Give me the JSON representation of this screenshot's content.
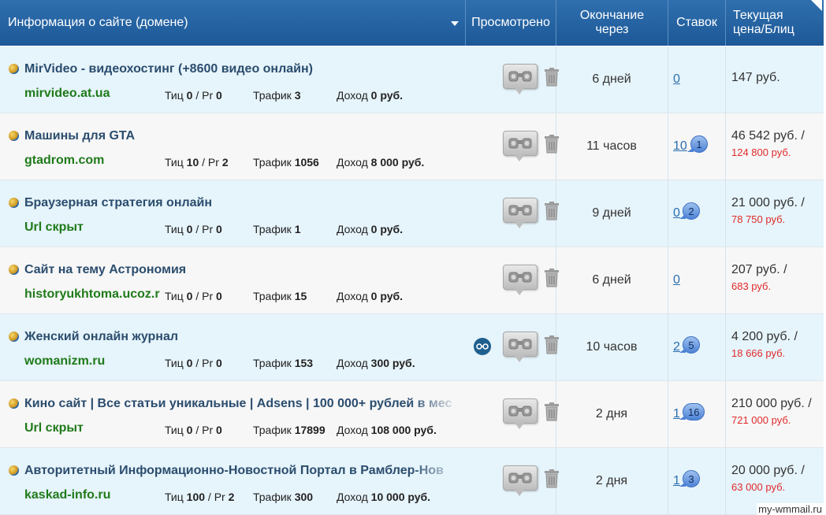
{
  "header": {
    "site_info": "Информация о сайте (домене)",
    "viewed": "Просмотрено",
    "ending_line1": "Окончание",
    "ending_line2": "через",
    "bids": "Ставок",
    "price_line1": "Текущая",
    "price_line2": "цена/Блиц"
  },
  "labels": {
    "tic": "Тиц",
    "pr": "/ Pr",
    "traffic": "Трафик",
    "income": "Доход"
  },
  "rows": [
    {
      "title": "MirVideo - видеохостинг (+8600 видео онлайн)",
      "domain": "mirvideo.at.ua",
      "tic": "0",
      "pr": "0",
      "traffic": "3",
      "income": "0 руб.",
      "ending": "6 дней",
      "bids": "0",
      "bubble": "",
      "viewers": "",
      "price": "147 руб.",
      "blitz": ""
    },
    {
      "title": "Машины для GTA",
      "domain": "gtadrom.com",
      "tic": "10",
      "pr": "2",
      "traffic": "1056",
      "income": "8 000 руб.",
      "ending": "11 часов",
      "bids": "10",
      "bubble": "1",
      "viewers": "",
      "price": "46 542 руб. /",
      "blitz": "124 800 руб."
    },
    {
      "title": "Браузерная стратегия онлайн",
      "domain": "Url скрыт",
      "tic": "0",
      "pr": "0",
      "traffic": "1",
      "income": "0 руб.",
      "ending": "9 дней",
      "bids": "0",
      "bubble": "2",
      "viewers": "",
      "price": "21 000 руб. /",
      "blitz": "78 750 руб."
    },
    {
      "title": "Сайт на тему Астрономия",
      "domain": "historyukhtoma.ucoz.r",
      "tic": "0",
      "pr": "0",
      "traffic": "15",
      "income": "0 руб.",
      "ending": "6 дней",
      "bids": "0",
      "bubble": "",
      "viewers": "",
      "price": "207 руб. /",
      "blitz": "683 руб."
    },
    {
      "title": "Женский онлайн журнал",
      "domain": "womanizm.ru",
      "tic": "0",
      "pr": "0",
      "traffic": "153",
      "income": "300 руб.",
      "ending": "10 часов",
      "bids": "2",
      "bubble": "5",
      "viewers": "eyes",
      "price": "4 200 руб. /",
      "blitz": "18 666 руб."
    },
    {
      "title": "Кино сайт | Все статьи уникальные | Adsens | 100 000+ рублей в мес",
      "domain": "Url скрыт",
      "tic": "0",
      "pr": "0",
      "traffic": "17899",
      "income": "108 000 руб.",
      "ending": "2 дня",
      "bids": "1",
      "bubble": "16",
      "viewers": "",
      "price": "210 000 руб. /",
      "blitz": "721 000 руб."
    },
    {
      "title": "Авторитетный Информационно-Новостной Портал в Рамблер-Нов",
      "domain": "kaskad-info.ru",
      "tic": "100",
      "pr": "2",
      "traffic": "300",
      "income": "10 000 руб.",
      "ending": "2 дня",
      "bids": "1",
      "bubble": "3",
      "viewers": "",
      "price": "20 000 руб. /",
      "blitz": "63 000 руб."
    }
  ],
  "watermark": "my-wmmail.ru",
  "colors": {
    "header": "#1d5897",
    "row_odd": "#e6f4fb",
    "row_even": "#f7f7f7",
    "domain": "#1f7a1a",
    "blitz": "#e02a2a",
    "link": "#2a6fae"
  }
}
